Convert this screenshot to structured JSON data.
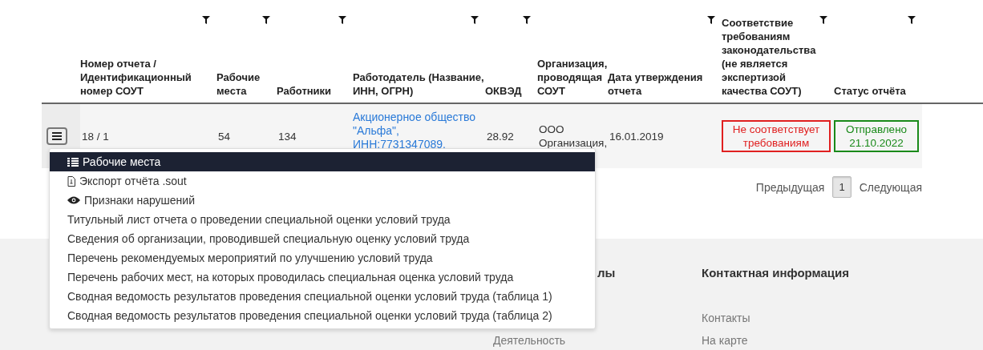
{
  "table": {
    "columns": [
      {
        "label": "Номер отчета / Идентификационный номер СОУТ",
        "filter": true
      },
      {
        "label": "Рабочие места",
        "filter": true
      },
      {
        "label": "Работники",
        "filter": true
      },
      {
        "label": "Работодатель (Название, ИНН, ОГРН)",
        "filter": true
      },
      {
        "label": "ОКВЭД",
        "filter": true
      },
      {
        "label": "Организация, проводящая СОУТ",
        "filter": false
      },
      {
        "label": "Дата утверждения отчета",
        "filter": true
      },
      {
        "label": "Соответствие требованиям законодательства (не является экспертизой качества СОУТ)",
        "filter": true
      },
      {
        "label": "Статус отчёта",
        "filter": true
      }
    ],
    "rows": [
      {
        "cells": [
          {
            "kind": "text",
            "text": "18 / 1"
          },
          {
            "kind": "text",
            "text": "54"
          },
          {
            "kind": "text",
            "text": "134"
          },
          {
            "kind": "link",
            "text": "Акционерное общество \"Альфа\", ИНН:7731347089."
          },
          {
            "kind": "text",
            "text": "28.92"
          },
          {
            "kind": "text",
            "text": "ООО Организация,"
          },
          {
            "kind": "text",
            "text": "16.01.2019"
          },
          {
            "kind": "badge",
            "text": "Не соответствует требованиям",
            "color": "#e02020"
          },
          {
            "kind": "badge",
            "text": "Отправлено 21.10.2022",
            "color": "#1a8a1a"
          }
        ]
      }
    ]
  },
  "menu": [
    {
      "kind": "list",
      "label": "Рабочие места",
      "selected": true
    },
    {
      "kind": "file",
      "label": "Экспорт отчёта .sout",
      "selected": false
    },
    {
      "kind": "eye",
      "label": "Признаки нарушений",
      "selected": false
    },
    {
      "kind": "plain",
      "label": "Титульный лист отчета о проведении специальной оценки условий труда",
      "selected": false
    },
    {
      "kind": "plain",
      "label": "Сведения об организации, проводившей специальную оценку условий труда",
      "selected": false
    },
    {
      "kind": "plain",
      "label": "Перечень рекомендуемых мероприятий по улучшению условий труда",
      "selected": false
    },
    {
      "kind": "plain",
      "label": "Перечень рабочих мест, на которых проводилась специальная оценка условий труда",
      "selected": false
    },
    {
      "kind": "plain",
      "label": "Сводная ведомость результатов проведения специальной оценки условий труда (таблица 1)",
      "selected": false
    },
    {
      "kind": "plain",
      "label": "Сводная ведомость результатов проведения специальной оценки условий труда (таблица 2)",
      "selected": false
    }
  ],
  "pagination": {
    "previous": "Предыдущая",
    "pages": [
      {
        "label": "1",
        "selected": true
      }
    ],
    "next": "Следующая"
  },
  "footer": {
    "columns": [
      {
        "heading": "лы",
        "links": [
          "Деятельность"
        ]
      },
      {
        "heading": "Контактная информация",
        "links": [
          "Контакты",
          "На карте"
        ]
      }
    ]
  }
}
